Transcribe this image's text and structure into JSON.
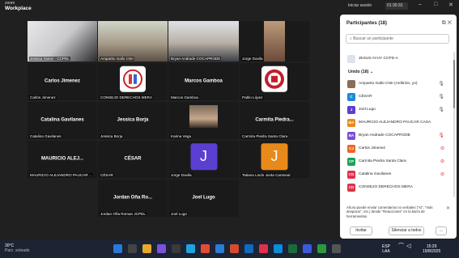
{
  "titlebar": {
    "brand_line1": "zoom",
    "brand_line2": "Workplace",
    "login": "Iniciar sesión",
    "rec_timer": "01:30:33"
  },
  "tiles": [
    {
      "name": "Jessica Yanez - CCPDL",
      "big": ""
    },
    {
      "name": "Amparito Gallo CNII",
      "big": ""
    },
    {
      "name": "Bryan Andrade COCAPRODE",
      "big": ""
    },
    {
      "name": "Jorge Davila",
      "big": ""
    },
    {
      "name": "Carlos Jimenez",
      "big": "Carlos  Jimenez"
    },
    {
      "name": "CONSEJO DERECHOS MERA",
      "big": ""
    },
    {
      "name": "Marcos Gamboa",
      "big": "Marcos Gamboa"
    },
    {
      "name": "Pablo López",
      "big": ""
    },
    {
      "name": "Catalina Gavilanes",
      "big": "Catalina Gavilanes"
    },
    {
      "name": "Jessica Borja",
      "big": "Jessica Borja"
    },
    {
      "name": "Karina Vega",
      "big": ""
    },
    {
      "name": "Carmita Piedra Santa Clara",
      "big": "Carmita  Piedra..."
    },
    {
      "name": "MAURICIO ALEJANDRO PAUCAR ...",
      "big": "MAURICIO ALEJ..."
    },
    {
      "name": "CÉSAR",
      "big": "CÉSAR"
    },
    {
      "name": "Jorge Davila",
      "big": "",
      "avatar": "J"
    },
    {
      "name": "Tatiana Lindo Junta Cantonal",
      "big": "",
      "avatar": "J"
    },
    {
      "name": "Jordan Oña Roman JCPDL",
      "big": "Jordan Oña  Ro..."
    },
    {
      "name": "Joel Lugo",
      "big": "Joel Lugo"
    }
  ],
  "panel": {
    "title": "Participantes (18)",
    "search_placeholder": "Buscar un participante",
    "prev_item": "JESUS AYUY CCPD-A",
    "section": "Unido (18)",
    "participants": [
      {
        "initials": "",
        "name": "Amparito Gallo CNII (Anfitrión, yo)",
        "color": "#8a6d5a"
      },
      {
        "initials": "C",
        "name": "CÉSAR",
        "color": "#1a8ad4"
      },
      {
        "initials": "J",
        "name": "Joel Lugo",
        "color": "#5b3fd1"
      },
      {
        "initials": "MA",
        "name": "MAURICIO ALEJANDRO PAUCAR CASA",
        "color": "#e88a1a"
      },
      {
        "initials": "BA",
        "name": "Bryan Andrade COCAPRODE",
        "color": "#7a4fd4"
      },
      {
        "initials": "CJ",
        "name": "Carlos  Jimenez",
        "color": "#e56a2a"
      },
      {
        "initials": "CP",
        "name": "Carmita Piedra Santa Clara",
        "color": "#1aa356"
      },
      {
        "initials": "CG",
        "name": "Catalina Gavilanes",
        "color": "#e0304a"
      },
      {
        "initials": "CD",
        "name": "CONSEJO DERECHOS MERA",
        "color": "#e0304a"
      }
    ],
    "note": "Ahora puede enviar comentarios no verbales (\"sí\", \"más despacio\", etc.) desde \"Reacciones\" en la barra de herramientas.",
    "invite_label": "Invitar",
    "mute_all_label": "Silenciar a todos",
    "more_label": "..."
  },
  "taskbar": {
    "temp": "30°C",
    "weather": "Parc. soleado",
    "lang1": "ESP",
    "lang2": "LAA",
    "time": "15:29",
    "date": "19/8/2025"
  }
}
